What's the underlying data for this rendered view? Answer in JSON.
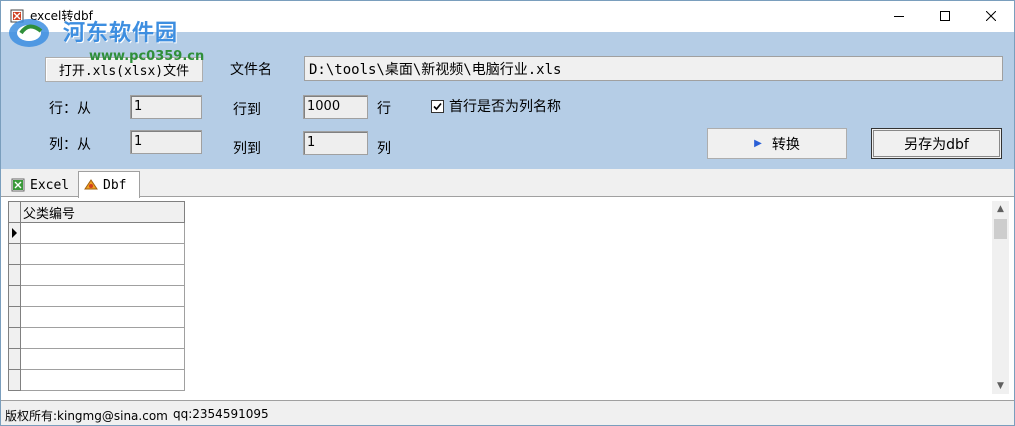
{
  "window": {
    "title": "excel转dbf",
    "controls": {
      "minimize": "—",
      "maximize": "☐",
      "close": "✕"
    }
  },
  "watermark": {
    "title": "河东软件园",
    "url": "www.pc0359.cn"
  },
  "form": {
    "open_button": "打开.xls(xlsx)文件",
    "filename_label": "文件名",
    "filename_value": "D:\\tools\\桌面\\新视频\\电脑行业.xls",
    "row_from_label": "行：从",
    "row_from_value": "1",
    "row_to_label": "行到",
    "row_to_value": "1000",
    "row_suffix": "行",
    "first_row_header_label": "首行是否为列名称",
    "first_row_header_checked": true,
    "col_from_label": "列：从",
    "col_from_value": "1",
    "col_to_label": "列到",
    "col_to_value": "1",
    "col_suffix": "列",
    "convert_button": "转换",
    "save_button": "另存为dbf"
  },
  "tabs": [
    {
      "label": "Excel",
      "icon": "excel-icon",
      "active": false
    },
    {
      "label": "Dbf",
      "icon": "dbf-icon",
      "active": true
    }
  ],
  "grid": {
    "columns": [
      "父类编号"
    ],
    "rows": [
      "",
      "",
      "",
      "",
      "",
      "",
      "",
      ""
    ]
  },
  "status": {
    "copyright": "版权所有:kingmg@sina.com",
    "qq": "qq:2354591095"
  },
  "colors": {
    "panel": "#b5cde6",
    "accent": "#2a5fd6",
    "watermark_blue": "#3d8ee0",
    "watermark_green": "#2f8f3a"
  }
}
